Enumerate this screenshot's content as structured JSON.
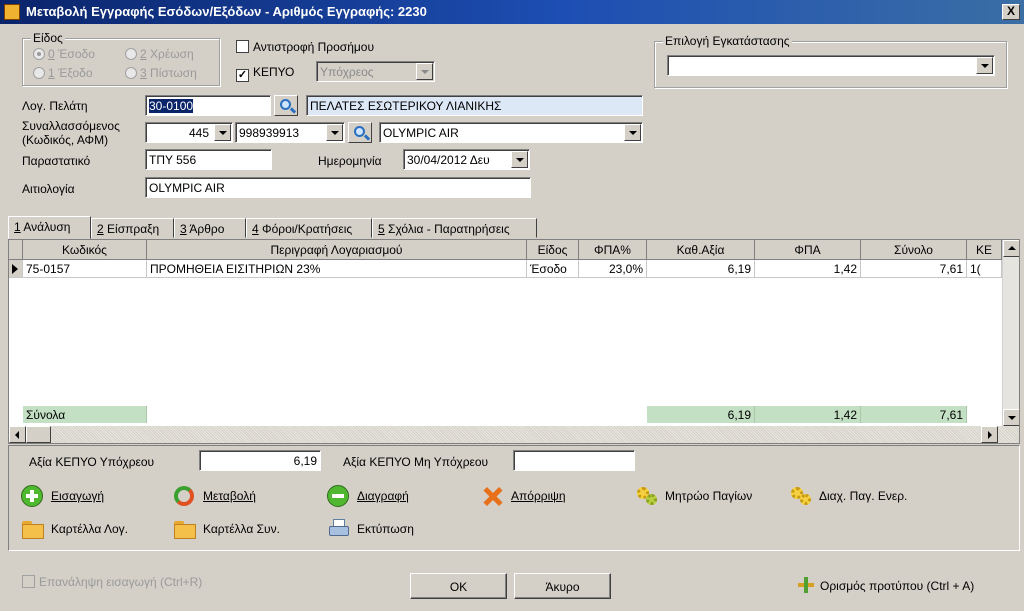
{
  "window": {
    "title": "Μεταβολή Εγγραφής Εσόδων/Εξόδων - Αριθμός Εγγραφής: 2230",
    "close_label": "X"
  },
  "eidos": {
    "legend": "Είδος",
    "options": [
      {
        "num": "0",
        "label": " Έσοδο",
        "checked": true
      },
      {
        "num": "2",
        "label": " Χρέωση",
        "checked": false
      },
      {
        "num": "1",
        "label": " Έξοδο",
        "checked": false
      },
      {
        "num": "3",
        "label": " Πίστωση",
        "checked": false
      }
    ]
  },
  "antistrofi": {
    "label": "Αντιστροφή Προσήμου",
    "checked": false
  },
  "kepyo": {
    "label": "ΚΕΠΥΟ",
    "checked": true,
    "value": "Υπόχρεος"
  },
  "installation": {
    "legend": "Επιλογή Εγκατάστασης",
    "value": ""
  },
  "form": {
    "customer_label": "Λογ. Πελάτη",
    "customer_code": "30-0100",
    "customer_name": "ΠΕΛΑΤΕΣ ΕΣΩΤΕΡΙΚΟΥ ΛΙΑΝΙΚΗΣ",
    "counterparty_label_1": "Συναλλασσόμενος",
    "counterparty_label_2": "(Κωδικός, ΑΦΜ)",
    "counterparty_code": "445",
    "counterparty_afm": "998939913",
    "counterparty_name": "OLYMPIC AIR",
    "document_label": "Παραστατικό",
    "document_value": "ΤΠΥ 556",
    "date_label": "Ημερομηνία",
    "date_value": "30/04/2012 Δευ",
    "reason_label": "Αιτιολογία",
    "reason_value": "OLYMPIC AIR"
  },
  "tabs": [
    {
      "num": "1",
      "label": " Ανάλυση"
    },
    {
      "num": "2",
      "label": " Είσπραξη"
    },
    {
      "num": "3",
      "label": " Άρθρο"
    },
    {
      "num": "4",
      "label": " Φόροι/Κρατήσεις"
    },
    {
      "num": "5",
      "label": " Σχόλια - Παρατηρήσεις"
    }
  ],
  "grid": {
    "columns": [
      "Κωδικός",
      "Περιγραφή Λογαριασμού",
      "Είδος",
      "ΦΠΑ%",
      "Καθ.Αξία",
      "ΦΠΑ",
      "Σύνολο",
      "ΚΕ"
    ],
    "rows": [
      {
        "code": "75-0157",
        "description": "ΠΡΟΜΗΘΕΙΑ ΕΙΣΙΤΗΡΙΩΝ 23%",
        "type": "Έσοδο",
        "vat_pct": "23,0%",
        "net": "6,19",
        "vat": "1,42",
        "total": "7,61",
        "ke": "1("
      }
    ],
    "totals_label": "Σύνολα",
    "totals": {
      "net": "6,19",
      "vat": "1,42",
      "total": "7,61"
    }
  },
  "kepyo_values": {
    "obliged_label": "Αξία ΚΕΠΥΟ Υπόχρεου",
    "obliged_value": "6,19",
    "not_obliged_label": "Αξία ΚΕΠΥΟ Μη Υπόχρεου",
    "not_obliged_value": ""
  },
  "actions": {
    "insert": "Εισαγωγή",
    "modify": "Μεταβολή",
    "delete": "Διαγραφή",
    "reject": "Απόρριψη",
    "assets_register": "Μητρώο Παγίων",
    "manage_assets": "Διαχ. Παγ. Ενερ.",
    "account_card": "Καρτέλλα Λογ.",
    "counterparty_card": "Καρτέλλα Συν.",
    "print": "Εκτύπωση"
  },
  "footer": {
    "repeat_label": "Επανάληψη εισαγωγή (Ctrl+R)",
    "ok": "OK",
    "cancel": "Άκυρο",
    "template": "Ορισμός προτύπου (Ctrl + A)"
  },
  "colors": {
    "title_bar": "#0a246a",
    "totals_bg": "#c4e0c4",
    "customer_name_bg": "#dde8f6"
  }
}
